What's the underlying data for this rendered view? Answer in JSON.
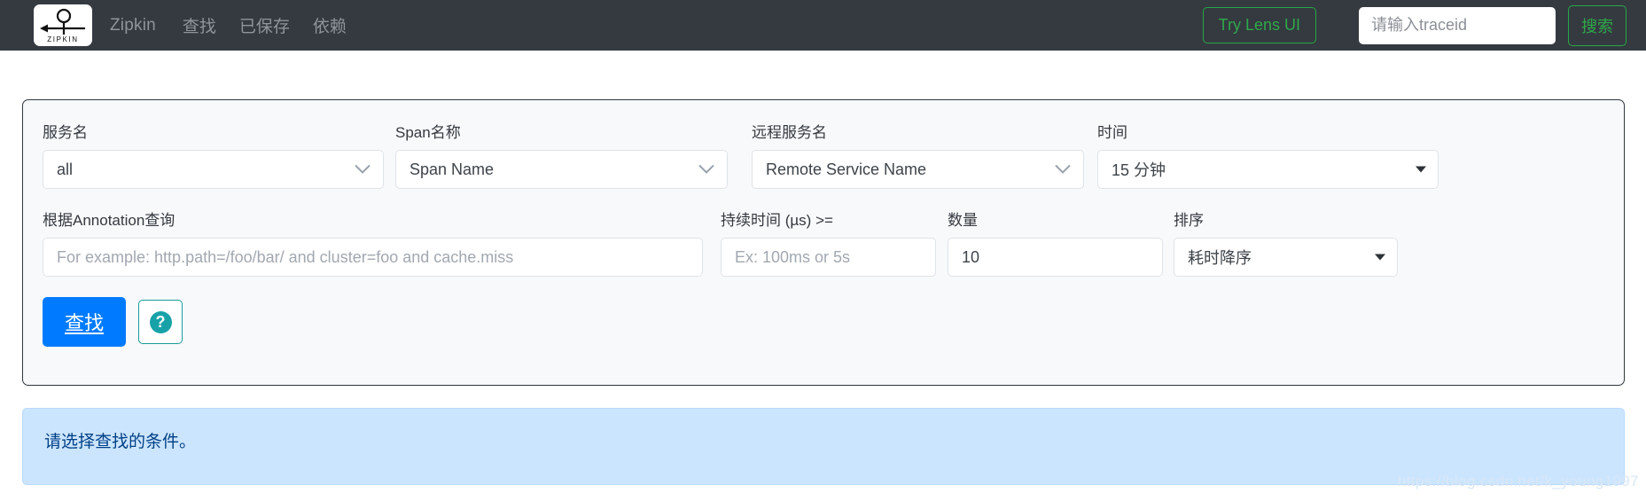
{
  "navbar": {
    "logo_alt": "ZIPKIN",
    "logo_text": "ZIPKIN",
    "brand": "Zipkin",
    "links": [
      {
        "label": "查找",
        "name": "nav-find"
      },
      {
        "label": "已保存",
        "name": "nav-saved"
      },
      {
        "label": "依赖",
        "name": "nav-dependencies"
      }
    ],
    "lens_button": "Try Lens UI",
    "trace_input_placeholder": "请输入traceid",
    "trace_input_value": "",
    "search_button": "搜索",
    "colors": {
      "background": "#343a40",
      "text": "#8f949b",
      "accent_green": "#28a745"
    }
  },
  "search_form": {
    "row1": {
      "service": {
        "label": "服务名",
        "value": "all",
        "icon": "chevron-down-icon"
      },
      "span": {
        "label": "Span名称",
        "placeholder": "Span Name",
        "value": "",
        "icon": "chevron-down-icon"
      },
      "remote_service": {
        "label": "远程服务名",
        "placeholder": "Remote Service Name",
        "value": "",
        "icon": "chevron-down-icon"
      },
      "time": {
        "label": "时间",
        "value": "15 分钟",
        "icon": "caret-down-icon"
      }
    },
    "row2": {
      "annotation": {
        "label": "根据Annotation查询",
        "placeholder": "For example: http.path=/foo/bar/ and cluster=foo and cache.miss",
        "value": ""
      },
      "duration": {
        "label": "持续时间 (µs) >=",
        "placeholder": "Ex: 100ms or 5s",
        "value": ""
      },
      "limit": {
        "label": "数量",
        "value": "10"
      },
      "sort": {
        "label": "排序",
        "value": "耗时降序",
        "icon": "caret-down-icon"
      }
    },
    "find_button": "查找",
    "help_button_icon": "question-mark-circle-icon",
    "help_button_glyph": "?",
    "colors": {
      "card_background": "#f8f9fa",
      "card_border": "#303640",
      "find_button": "#007bff",
      "help_accent": "#17a2a8"
    }
  },
  "info_banner": {
    "message": "请选择查找的条件。",
    "colors": {
      "background": "#cce5ff",
      "text": "#004085"
    }
  },
  "watermark": {
    "text": "https://blog.csdn.net/k_young1997"
  }
}
